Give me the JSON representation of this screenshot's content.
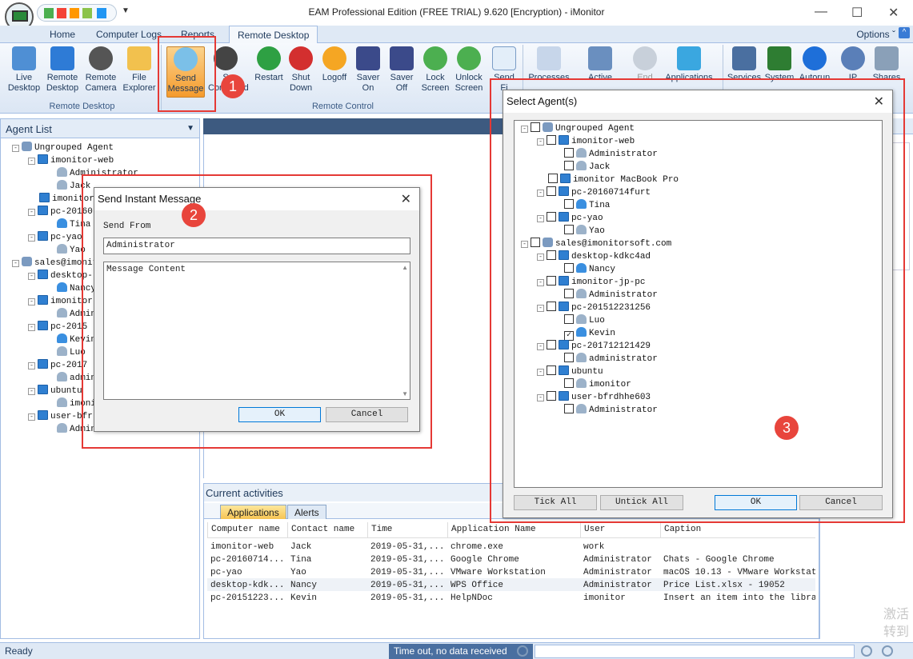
{
  "window": {
    "title": "EAM Professional Edition (FREE TRIAL) 9.620 [Encryption) - iMonitor",
    "minimize": "—",
    "maximize": "☐",
    "close": "✕"
  },
  "ribbon_tabs": [
    "Home",
    "Computer Logs",
    "Reports",
    "Remote Desktop"
  ],
  "options_label": "Options ˇ",
  "remote_desktop_group": {
    "label": "Remote Desktop",
    "buttons": [
      {
        "line1": "Live",
        "line2": "Desktop"
      },
      {
        "line1": "Remote",
        "line2": "Desktop"
      },
      {
        "line1": "Remote",
        "line2": "Camera"
      },
      {
        "line1": "File",
        "line2": "Explorer"
      }
    ]
  },
  "remote_control_group": {
    "label": "Remote Control",
    "buttons": [
      {
        "line1": "Send",
        "line2": "Message"
      },
      {
        "line1": "S",
        "line2": "Command"
      },
      {
        "line1": "Restart",
        "line2": ""
      },
      {
        "line1": "Shut",
        "line2": "Down"
      },
      {
        "line1": "Logoff",
        "line2": ""
      },
      {
        "line1": "Saver",
        "line2": "On"
      },
      {
        "line1": "Saver",
        "line2": "Off"
      },
      {
        "line1": "Lock",
        "line2": "Screen"
      },
      {
        "line1": "Unlock",
        "line2": "Screen"
      },
      {
        "line1": "Send",
        "line2": "Fi"
      }
    ]
  },
  "more_tools": [
    "Processes",
    "Active",
    "End",
    "Applications",
    "Services",
    "System",
    "Autorun",
    "IP",
    "Shares"
  ],
  "agent_list": {
    "header": "Agent List",
    "items": [
      "Ungrouped Agent",
      "imonitor-web",
      "Administrator",
      "Jack",
      "imonitor",
      "pc-20160",
      "Tina",
      "pc-yao",
      "Yao",
      "sales@imonit",
      "desktop-",
      "Nancy",
      "imonitor",
      "Admin",
      "pc-2015",
      "Kevin",
      "Luo",
      "pc-2017",
      "admin",
      "ubuntu",
      "imoni",
      "user-bfr",
      "Admin"
    ]
  },
  "send_message_dialog": {
    "title": "Send Instant Message",
    "send_from_label": "Send From",
    "send_from_value": "Administrator",
    "message_placeholder": "Message Content",
    "ok": "OK",
    "cancel": "Cancel"
  },
  "select_agents_dialog": {
    "title": "Select Agent(s)",
    "tree": [
      {
        "label": "Ungrouped Agent",
        "type": "group",
        "checked": false
      },
      {
        "label": "imonitor-web",
        "type": "pc",
        "checked": false
      },
      {
        "label": "Administrator",
        "type": "user",
        "checked": false
      },
      {
        "label": "Jack",
        "type": "user",
        "checked": false
      },
      {
        "label": "imonitor MacBook Pro",
        "type": "pc",
        "checked": false
      },
      {
        "label": "pc-20160714furt",
        "type": "pc",
        "checked": false
      },
      {
        "label": "Tina",
        "type": "user-active",
        "checked": false
      },
      {
        "label": "pc-yao",
        "type": "pc",
        "checked": false
      },
      {
        "label": "Yao",
        "type": "user",
        "checked": false
      },
      {
        "label": "sales@imonitorsoft.com",
        "type": "group",
        "checked": false
      },
      {
        "label": "desktop-kdkc4ad",
        "type": "pc",
        "checked": false
      },
      {
        "label": "Nancy",
        "type": "user-active",
        "checked": false
      },
      {
        "label": "imonitor-jp-pc",
        "type": "pc",
        "checked": false
      },
      {
        "label": "Administrator",
        "type": "user",
        "checked": false
      },
      {
        "label": "pc-201512231256",
        "type": "pc",
        "checked": false
      },
      {
        "label": "Luo",
        "type": "user",
        "checked": false
      },
      {
        "label": "Kevin",
        "type": "user-active",
        "checked": true
      },
      {
        "label": "pc-201712121429",
        "type": "pc",
        "checked": false
      },
      {
        "label": "administrator",
        "type": "user",
        "checked": false
      },
      {
        "label": "ubuntu",
        "type": "pc",
        "checked": false
      },
      {
        "label": "imonitor",
        "type": "user",
        "checked": false
      },
      {
        "label": "user-bfrdhhe603",
        "type": "pc",
        "checked": false
      },
      {
        "label": "Administrator",
        "type": "user",
        "checked": false
      }
    ],
    "tick_all": "Tick All",
    "untick_all": "Untick All",
    "ok": "OK",
    "cancel": "Cancel"
  },
  "activities": {
    "title": "Current activities",
    "tabs": [
      "Applications",
      "Alerts"
    ],
    "columns": [
      "Computer name",
      "Contact name",
      "Time",
      "Application Name",
      "User",
      "Caption"
    ],
    "rows": [
      [
        "imonitor-web",
        "Jack",
        "2019-05-31,...",
        "chrome.exe",
        "work",
        ""
      ],
      [
        "pc-20160714...",
        "Tina",
        "2019-05-31,...",
        "Google Chrome",
        "Administrator",
        "Chats - Google Chrome"
      ],
      [
        "pc-yao",
        "Yao",
        "2019-05-31,...",
        "VMware Workstation",
        "Administrator",
        "macOS 10.13 - VMware Workstation"
      ],
      [
        "desktop-kdk...",
        "Nancy",
        "2019-05-31,...",
        "WPS Office",
        "Administrator",
        "Price List.xlsx - 19052"
      ],
      [
        "pc-20151223...",
        "Kevin",
        "2019-05-31,...",
        "HelpNDoc",
        "imonitor",
        "Insert an item into the library"
      ]
    ]
  },
  "statusbar": {
    "left": "Ready",
    "mid": "Time out, no data received"
  },
  "annotations": [
    "1",
    "2",
    "3"
  ],
  "watermark": [
    "激活",
    "转到"
  ],
  "colors": {
    "annotation_red": "#e53935",
    "selected_button": "#f59b2d",
    "ribbon_bg": "#dfe9f5"
  }
}
